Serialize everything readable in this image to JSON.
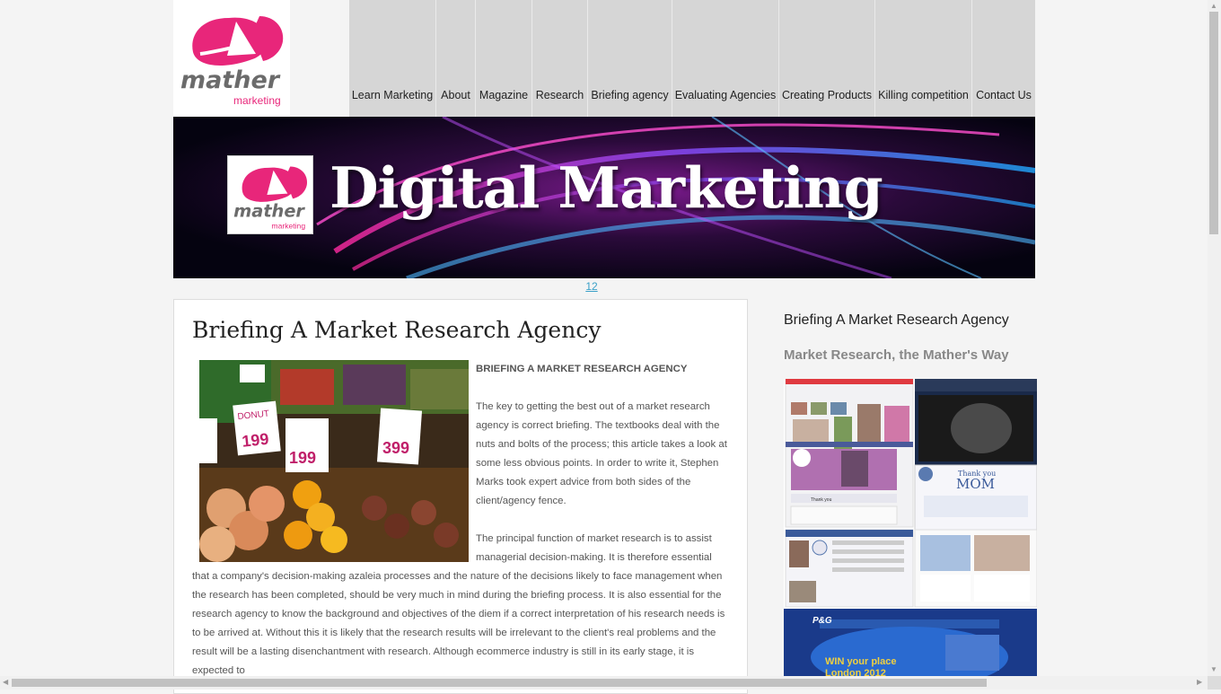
{
  "brand": {
    "logo_word": "mather",
    "logo_sub": "marketing",
    "pink": "#e8267a"
  },
  "nav": {
    "items": [
      {
        "label": "Learn Marketing"
      },
      {
        "label": "About"
      },
      {
        "label": "Magazine"
      },
      {
        "label": "Research"
      },
      {
        "label": "Briefing agency"
      },
      {
        "label": "Evaluating Agencies"
      },
      {
        "label": "Creating Products"
      },
      {
        "label": "Killing competition"
      },
      {
        "label": "Contact Us"
      }
    ]
  },
  "banner": {
    "title": "Digital Marketing"
  },
  "pager": {
    "link": "12"
  },
  "article": {
    "title": "Briefing A Market Research Agency",
    "image_icon": "market-produce-photo",
    "heading": "BRIEFING A MARKET RESEARCH AGENCY",
    "paragraphs": [
      "The key to getting the best out of a market research agency is correct briefing. The textbooks deal with the nuts and bolts of the process; this article takes a look at some less obvious points. In order to write it, Stephen Marks took expert advice from both sides of the client/agency fence.",
      "The principal function of market research is to assist managerial decision-making. It is therefore essential that a company's decision-making azaleia processes and the nature of the decisions likely to face management when the research has been completed, should be very much in mind during the briefing process. It is also essential for the research agency to know the background and objectives of the diem if a correct interpretation of his research needs is to be arrived at. Without this it is likely that the research results will be irrelevant to the client's real problems and the result will be a lasting disenchantment with research. Although ecommerce industry is still in its early stage, it is expected to"
    ]
  },
  "sidebar": {
    "title": "Briefing A Market Research Agency",
    "subtitle": "Market Research, the Mather's Way",
    "collage": {
      "mom_text": "MOM",
      "thank_you": "Thank you",
      "pg": "P&G",
      "win_text": "WIN your place",
      "london": "London 2012"
    }
  }
}
